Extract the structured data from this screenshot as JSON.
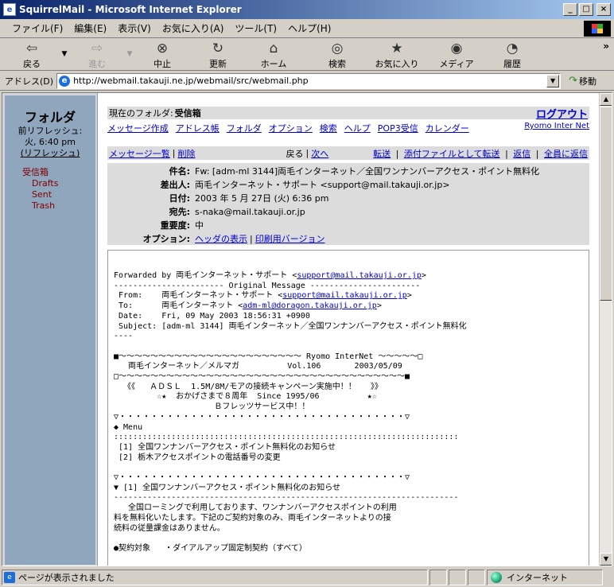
{
  "window": {
    "title": "SquirrelMail - Microsoft Internet Explorer",
    "app_icon": "e",
    "min": "_",
    "max": "□",
    "close": "×"
  },
  "menu": [
    "ファイル(F)",
    "編集(E)",
    "表示(V)",
    "お気に入り(A)",
    "ツール(T)",
    "ヘルプ(H)"
  ],
  "toolbar": {
    "back": "戻る",
    "forward": "進む",
    "stop": "中止",
    "refresh": "更新",
    "home": "ホーム",
    "search": "検索",
    "favorites": "お気に入り",
    "media": "メディア",
    "history": "履歴",
    "more": "»"
  },
  "address": {
    "label": "アドレス(D)",
    "url": "http://webmail.takauji.ne.jp/webmail/src/webmail.php",
    "go": "移動"
  },
  "left": {
    "title": "フォルダ",
    "refresh_label": "前リフレッシュ:",
    "refresh_time": "火, 6:40 pm",
    "refresh_link": "(リフレッシュ)",
    "folders": [
      "受信箱",
      "Drafts",
      "Sent",
      "Trash"
    ]
  },
  "topbar": {
    "current_label": "現在のフォルダ:",
    "current_value": "受信箱",
    "logout": "ログアウト"
  },
  "nav": {
    "items": [
      "メッセージ作成",
      "アドレス帳",
      "フォルダ",
      "オプション",
      "検索",
      "ヘルプ",
      "POP3受信",
      "カレンダー"
    ],
    "right": "Ryomo Inter Net"
  },
  "actions": {
    "list": "メッセージ一覧",
    "delete": "削除",
    "back": "戻る",
    "next": "次へ",
    "forward": "転送",
    "forward_attach": "添付ファイルとして転送",
    "reply": "返信",
    "reply_all": "全員に返信"
  },
  "headers": {
    "subject_label": "件名:",
    "subject": "Fw: [adm-ml 3144]両毛インターネット／全国ワンナンバーアクセス・ポイント無料化",
    "from_label": "差出人:",
    "from": "両毛インターネット・サポート <support@mail.takauji.or.jp>",
    "date_label": "日付:",
    "date": "2003 年 5 月 27日 (火) 6:36 pm",
    "to_label": "宛先:",
    "to": "s-naka@mail.takauji.or.jp",
    "priority_label": "重要度:",
    "priority": "中",
    "options_label": "オプション:",
    "view_headers": "ヘッダの表示",
    "print_view": "印刷用バージョン"
  },
  "body": {
    "l1_a": "Forwarded by 両毛インターネット・サポート <",
    "l1_link": "support@mail.takauji.or.jp",
    "l1_b": ">",
    "l2": "----------------------- Original Message -----------------------",
    "l3_a": " From:    両毛インターネット・サポート <",
    "l3_link": "support@mail.takauji.or.jp",
    "l3_b": ">",
    "l4_a": " To:      両毛インターネット <",
    "l4_link": "adm-ml@doragon.takauji.or.jp",
    "l4_b": ">",
    "l5": " Date:    Fri, 09 May 2003 18:56:31 +0900",
    "l6": " Subject: [adm-ml 3144] 両毛インターネット／全国ワンナンバーアクセス・ポイント無料化",
    "l7": "----",
    "l8": "",
    "l9": "■～～～～～～～～～～～～～～～～～～～～～～～ Ryomo InterNet ～～～～～□",
    "l10": "   両毛インターネット／メルマガ          Vol.106       2003/05/09",
    "l11": "□～～～～～～～～～～～～～～～～～～～～～～～～～～～～～～～～～～～～■",
    "l12": "  《《   ＡＤＳＬ  1.5M/8M/モアの接続キャンペーン実施中！！   》》",
    "l13": "         ☆★  おかげさまで８周年  Since 1995/06          ★☆",
    "l14": "                     Ｂフレッツサービス中！！",
    "l15": "▽・・・・・・・・・・・・・・・・・・・・・・・・・・・・・・・・・・・・▽",
    "l16": "◆ Menu",
    "l17": "::::::::::::::::::::::::::::::::::::::::::::::::::::::::::::::::::::::::",
    "l18": " [1] 全国ワンナンバーアクセス・ポイント無料化のお知らせ",
    "l19": " [2] 栃木アクセスポイントの電話番号の変更",
    "l20": "",
    "l21": "▽・・・・・・・・・・・・・・・・・・・・・・・・・・・・・・・・・・・・▽",
    "l22": "▼ [1] 全国ワンナンバーアクセス・ポイント無料化のお知らせ",
    "l23": "------------------------------------------------------------------------",
    "l24": "   全国ローミングで利用しております、ワンナンバーアクセスポイントの利用",
    "l25": "料を無料化いたします。下記のご契約対象のみ、両毛インターネットよりの接",
    "l26": "続料の従量課金はありません。",
    "l27": "",
    "l28": "●契約対象   ・ダイアルアップ固定制契約（すべて）"
  },
  "scrollbar": {
    "up": "▲",
    "down": "▼"
  },
  "status": {
    "text": "ページが表示されました",
    "zone": "インターネット"
  }
}
